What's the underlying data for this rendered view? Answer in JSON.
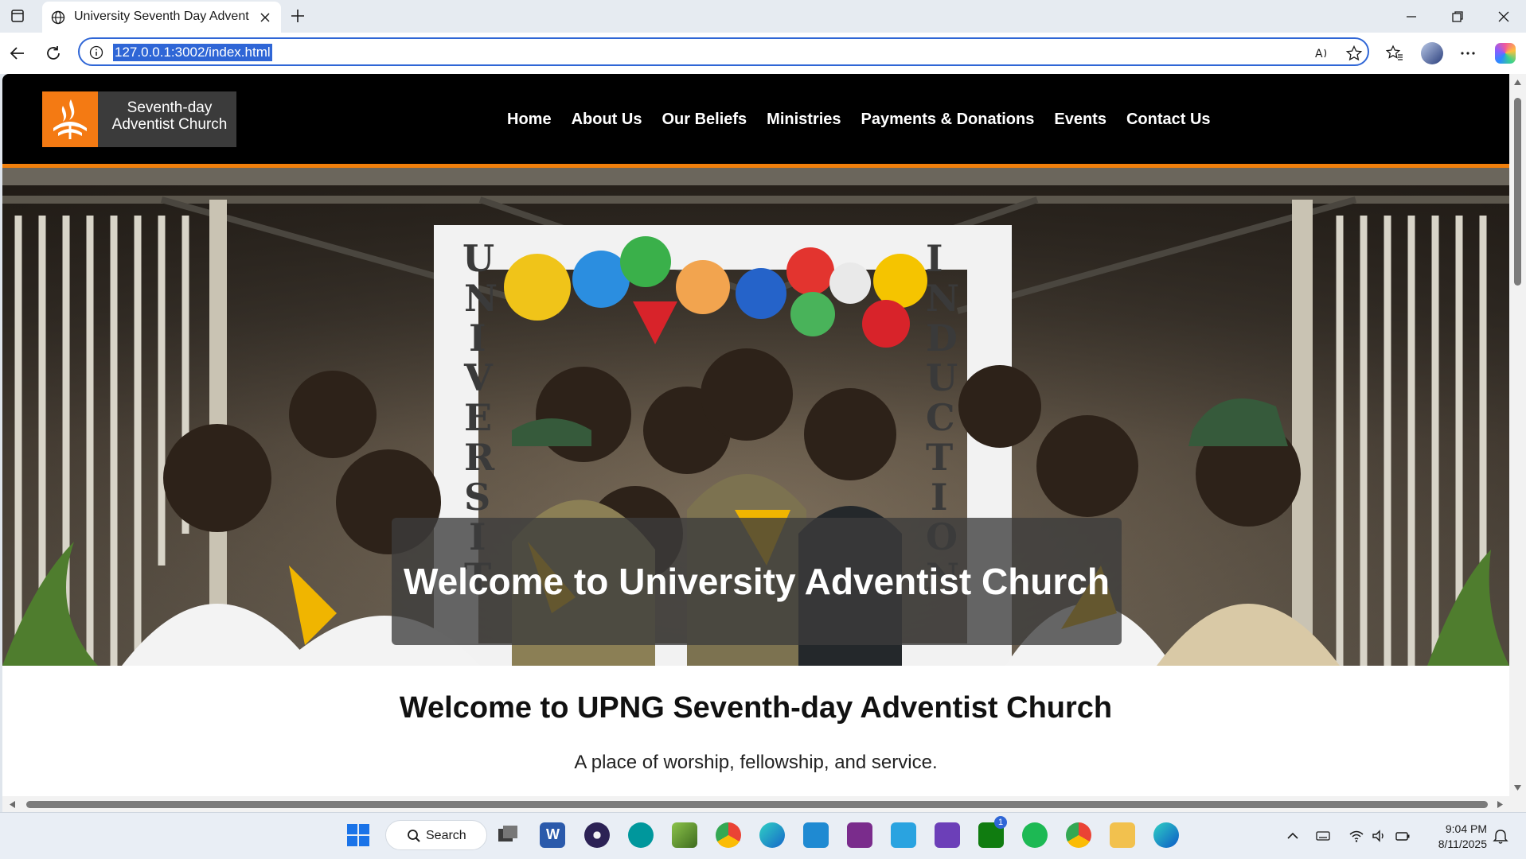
{
  "browser": {
    "tab_title": "University Seventh Day Adventist",
    "url": "127.0.0.1:3002/index.html"
  },
  "site": {
    "logo_line1": "Seventh-day",
    "logo_line2": "Adventist Church",
    "nav": [
      "Home",
      "About Us",
      "Our Beliefs",
      "Ministries",
      "Payments & Donations",
      "Events",
      "Contact Us"
    ],
    "hero_caption": "Welcome to University Adventist Church",
    "welcome_title": "Welcome to UPNG Seventh-day Adventist Church",
    "tagline": "A place of worship, fellowship, and service.",
    "accent_color": "#f07f0c",
    "header_bg": "#000000"
  },
  "taskbar": {
    "search_label": "Search",
    "time": "9:04 PM",
    "date": "8/11/2025",
    "xbox_badge": "1",
    "apps": [
      "start-icon",
      "search-icon",
      "task-view-icon",
      "word-icon",
      "eclipse-icon",
      "arduino-icon",
      "notepad-plus-icon",
      "chrome-icon",
      "edge-dev-icon",
      "vscode-icon",
      "app-icon",
      "remote-desktop-icon",
      "visual-studio-icon",
      "xbox-icon",
      "spotify-icon",
      "chrome-profile-icon",
      "file-explorer-icon",
      "edge-icon"
    ]
  }
}
